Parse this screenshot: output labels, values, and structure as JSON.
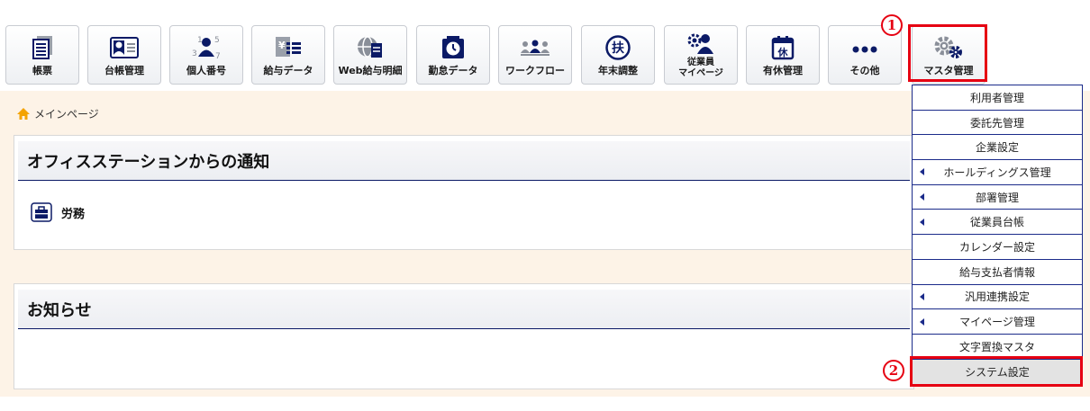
{
  "toolbar": {
    "items": [
      {
        "label": "帳票",
        "icon": "document-stack-icon"
      },
      {
        "label": "台帳管理",
        "icon": "id-card-icon"
      },
      {
        "label": "個人番号",
        "icon": "person-number-icon"
      },
      {
        "label": "給与データ",
        "icon": "yen-list-icon"
      },
      {
        "label": "Web給与明細",
        "icon": "globe-document-icon"
      },
      {
        "label": "勤怠データ",
        "icon": "clock-icon"
      },
      {
        "label": "ワークフロー",
        "icon": "people-flow-icon"
      },
      {
        "label": "年末調整",
        "icon": "fu-circle-icon"
      },
      {
        "label_line1": "従業員",
        "label_line2": "マイページ",
        "icon": "employee-gear-icon"
      },
      {
        "label": "有休管理",
        "icon": "calendar-kyu-icon"
      },
      {
        "label": "その他",
        "icon": "more-dots-icon"
      },
      {
        "label": "マスタ管理",
        "icon": "gears-icon"
      }
    ]
  },
  "markers": {
    "first": "1",
    "second": "2"
  },
  "breadcrumb": {
    "label": "メインページ",
    "icon": "home-icon"
  },
  "notice_panel": {
    "title": "オフィスステーションからの通知",
    "row_label": "労務",
    "row_icon": "briefcase-icon"
  },
  "news_panel": {
    "title": "お知らせ"
  },
  "dropdown": {
    "items": [
      {
        "label": "利用者管理",
        "arrow": false
      },
      {
        "label": "委託先管理",
        "arrow": false
      },
      {
        "label": "企業設定",
        "arrow": false
      },
      {
        "label": "ホールディングス管理",
        "arrow": true
      },
      {
        "label": "部署管理",
        "arrow": true
      },
      {
        "label": "従業員台帳",
        "arrow": true
      },
      {
        "label": "カレンダー設定",
        "arrow": false
      },
      {
        "label": "給与支払者情報",
        "arrow": false
      },
      {
        "label": "汎用連携設定",
        "arrow": true
      },
      {
        "label": "マイページ管理",
        "arrow": true
      },
      {
        "label": "文字置換マスタ",
        "arrow": false
      },
      {
        "label": "システム設定",
        "arrow": false
      }
    ]
  },
  "colors": {
    "accent": "#1b2b8a",
    "highlight": "#e60012",
    "icon": "#0b1a66",
    "icon_gray": "#8a8f99",
    "background": "#fdf3e7"
  }
}
